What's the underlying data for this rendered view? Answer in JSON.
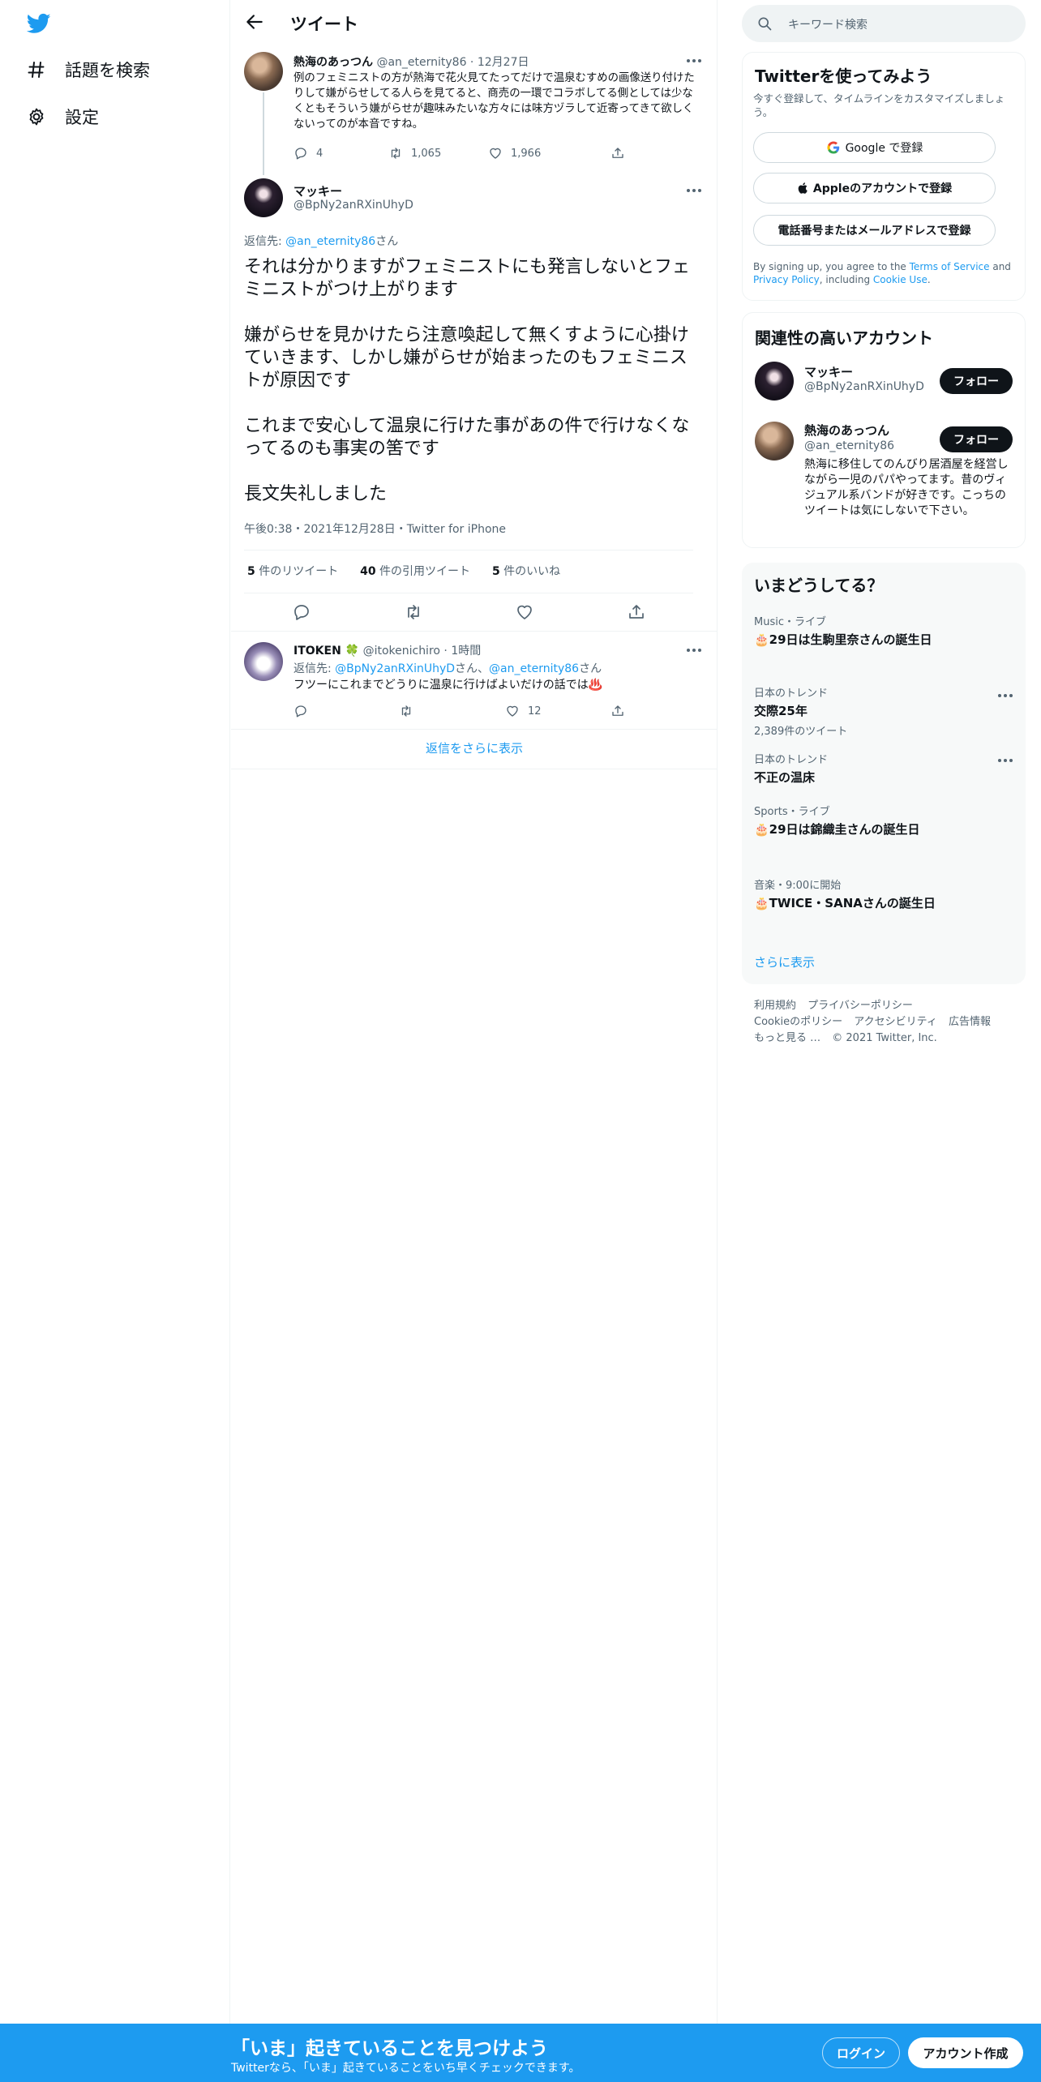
{
  "nav": {
    "logo_icon": "twitter-bird-icon",
    "items": [
      {
        "label": "話題を検索",
        "icon": "hashtag-icon"
      },
      {
        "label": "設定",
        "icon": "gear-icon"
      }
    ]
  },
  "header": {
    "title": "ツイート",
    "back_icon": "arrow-left-icon"
  },
  "parent_tweet": {
    "name": "熱海のあっつん",
    "handle": "@an_eternity86",
    "date": "12月27日",
    "text": "例のフェミニストの方が熱海で花火見てたってだけで温泉むすめの画像送り付けたりして嫌がらせしてる人らを見てると、商売の一環でコラボしてる側としては少なくともそういう嫌がらせが趣味みたいな方々には味方ヅラして近寄ってきて欲しくないってのが本音ですね。",
    "replies": "4",
    "retweets": "1,065",
    "likes": "1,966"
  },
  "main_tweet": {
    "name": "マッキー",
    "handle": "@BpNy2anRXinUhyD",
    "reply_prefix": "返信先: ",
    "reply_to": "@an_eternity86",
    "reply_suffix": "さん",
    "paragraphs": [
      "それは分かりますがフェミニストにも発言しないとフェミニストがつけ上がります",
      "嫌がらせを見かけたら注意喚起して無くすように心掛けていきます、しかし嫌がらせが始まったのもフェミニストが原因です",
      "これまで安心して温泉に行けた事があの件で行けなくなってるのも事実の筈です",
      "長文失礼しました"
    ],
    "timestamp": "午後0:38・2021年12月28日・Twitter for iPhone",
    "stats": {
      "retweet_count": "5",
      "retweet_label": " 件のリツイート",
      "quote_count": "40",
      "quote_label": " 件の引用ツイート",
      "like_count": "5",
      "like_label": " 件のいいね"
    }
  },
  "reply_tweet": {
    "name": "ITOKEN 🍀",
    "handle": "@itokenichiro",
    "time": "1時間",
    "reply_prefix": "返信先: ",
    "reply_to_1": "@BpNy2anRXinUhyD",
    "reply_mid": "さん、",
    "reply_to_2": "@an_eternity86",
    "reply_suffix": "さん",
    "text": "フツーにこれまでどうりに温泉に行けばよいだけの話では♨️",
    "likes": "12"
  },
  "show_more_replies": "返信をさらに表示",
  "right": {
    "search_placeholder": "キーワード検索",
    "signup": {
      "title": "Twitterを使ってみよう",
      "subtitle": "今すぐ登録して、タイムラインをカスタマイズしましょう。",
      "google": "Google で登録",
      "apple": "Appleのアカウントで登録",
      "phone": "電話番号またはメールアドレスで登録",
      "terms_1": "By signing up, you agree to the ",
      "terms_link1": "Terms of Service",
      "terms_2": " and ",
      "terms_link2": "Privacy Policy",
      "terms_3": ", including ",
      "terms_link3": "Cookie Use",
      "terms_4": "."
    },
    "related": {
      "title": "関連性の高いアカウント",
      "accounts": [
        {
          "name": "マッキー",
          "handle": "@BpNy2anRXinUhyD",
          "follow": "フォロー",
          "bio": ""
        },
        {
          "name": "熱海のあっつん",
          "handle": "@an_eternity86",
          "follow": "フォロー",
          "bio": "熱海に移住してのんびり居酒屋を経営しながら一児のパパやってます。昔のヴィジュアル系バンドが好きです。こっちのツイートは気にしないで下さい。"
        }
      ]
    },
    "trends": {
      "title": "いまどうしてる？",
      "items": [
        {
          "meta": "Music・ライブ",
          "name": "🎂29日は生駒里奈さんの誕生日",
          "sub": ""
        },
        {
          "meta": "日本のトレンド",
          "name": "交際25年",
          "sub": "2,389件のツイート"
        },
        {
          "meta": "日本のトレンド",
          "name": "不正の温床",
          "sub": ""
        },
        {
          "meta": "Sports・ライブ",
          "name": "🎂29日は錦織圭さんの誕生日",
          "sub": ""
        },
        {
          "meta": "音楽・9:00に開始",
          "name": "🎂TWICE・SANAさんの誕生日",
          "sub": ""
        }
      ],
      "show_more": "さらに表示"
    },
    "footer": {
      "links": [
        "利用規約",
        "プライバシーポリシー",
        "Cookieのポリシー",
        "アクセシビリティ",
        "広告情報",
        "もっと見る …"
      ],
      "copyright": "© 2021 Twitter, Inc."
    }
  },
  "bottom_bar": {
    "title": "「いま」起きていることを見つけよう",
    "subtitle": "Twitterなら、「いま」起きていることをいち早くチェックできます。",
    "login": "ログイン",
    "signup": "アカウント作成"
  },
  "colors": {
    "accent": "#1d9bf0",
    "text": "#0f1419",
    "muted": "#536471"
  }
}
